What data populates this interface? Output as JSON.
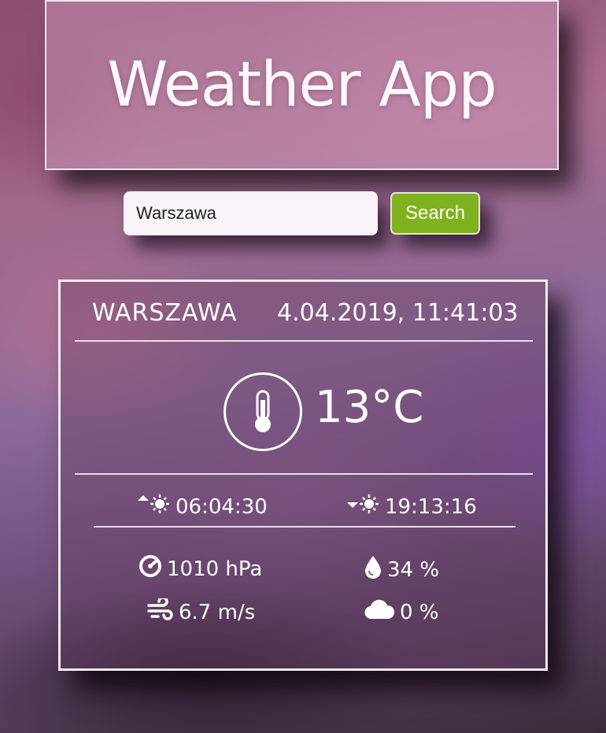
{
  "app": {
    "title": "Weather App"
  },
  "search": {
    "value": "Warszawa",
    "button_label": "Search"
  },
  "weather": {
    "city": "WARSZAWA",
    "datetime": "4.04.2019, 11:41:03",
    "temperature": "13°C",
    "sunrise": "06:04:30",
    "sunset": "19:13:16",
    "pressure": "1010 hPa",
    "humidity": "34 %",
    "wind": "6.7 m/s",
    "clouds": "0 %"
  },
  "icons": [
    "thermometer-icon",
    "sunrise-icon",
    "sunset-icon",
    "pressure-icon",
    "humidity-icon",
    "wind-icon",
    "cloud-icon"
  ],
  "colors": {
    "accent_button": "#7fb21e",
    "border": "#f4eaf1"
  }
}
